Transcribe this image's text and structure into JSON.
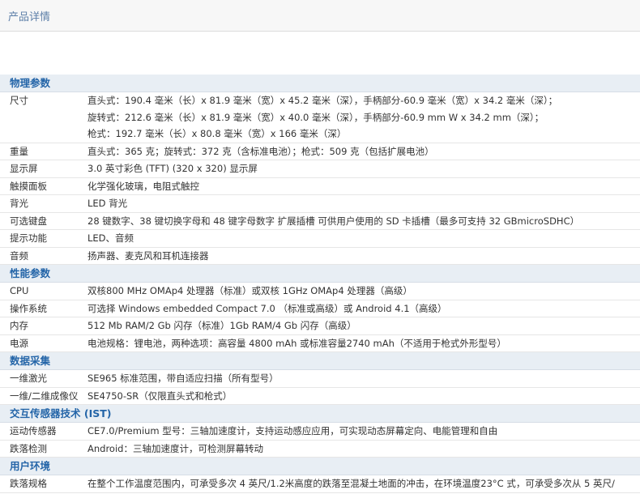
{
  "tab": {
    "label": "产品详情"
  },
  "sections": [
    {
      "title": "物理参数",
      "rows": [
        {
          "key": "尺寸",
          "lines": [
            "直头式：190.4 毫米（长）x 81.9 毫米（宽）x 45.2 毫米（深），手柄部分-60.9 毫米（宽）x 34.2 毫米（深）；",
            "旋转式：212.6 毫米（长）x 81.9 毫米（宽）x 40.0 毫米（深），手柄部分-60.9 mm W x 34.2 mm（深）；",
            "枪式：192.7 毫米（长）x 80.8 毫米（宽）x 166 毫米（深）"
          ]
        },
        {
          "key": "重量",
          "lines": [
            "直头式：365 克；旋转式：372 克（含标准电池）；枪式：509 克（包括扩展电池）"
          ]
        },
        {
          "key": "显示屏",
          "lines": [
            "3.0 英寸彩色 (TFT) (320 x 320) 显示屏"
          ]
        },
        {
          "key": "触摸面板",
          "lines": [
            "化学强化玻璃，电阻式触控"
          ]
        },
        {
          "key": "背光",
          "lines": [
            "LED 背光"
          ]
        },
        {
          "key": "可选键盘",
          "lines": [
            "28 键数字、38 键切换字母和 48 键字母数字 扩展插槽 可供用户使用的 SD 卡插槽（最多可支持 32 GBmicroSDHC）"
          ]
        },
        {
          "key": "提示功能",
          "lines": [
            "LED、音频"
          ]
        },
        {
          "key": "音频",
          "lines": [
            "扬声器、麦克风和耳机连接器"
          ]
        }
      ]
    },
    {
      "title": "性能参数",
      "rows": [
        {
          "key": "CPU",
          "lines": [
            "双核800 MHz OMAp4 处理器（标准）或双核 1GHz OMAp4 处理器（高级）"
          ]
        },
        {
          "key": "操作系统",
          "lines": [
            "可选择 Windows embedded Compact 7.0 （标准或高级）或 Android 4.1（高级）"
          ]
        },
        {
          "key": "内存",
          "lines": [
            "512 Mb RAM/2 Gb 闪存（标准）1Gb RAM/4 Gb 闪存（高级）"
          ]
        },
        {
          "key": "电源",
          "lines": [
            "电池规格：锂电池，两种选项：高容量 4800 mAh 或标准容量2740 mAh（不适用于枪式外形型号）"
          ]
        }
      ]
    },
    {
      "title": "数据采集",
      "rows": [
        {
          "key": "一维激光",
          "lines": [
            "SE965 标准范围，带自适应扫描（所有型号）"
          ]
        },
        {
          "key": "一维/二维成像仪",
          "lines": [
            "SE4750-SR（仅限直头式和枪式）"
          ]
        }
      ]
    },
    {
      "title": "交互传感器技术 (IST)",
      "rows": [
        {
          "key": "运动传感器",
          "lines": [
            "CE7.0/Premium 型号：三轴加速度计，支持运动感应应用，可实现动态屏幕定向、电能管理和自由"
          ]
        },
        {
          "key": "跌落检测",
          "lines": [
            "Android：三轴加速度计，可检测屏幕转动"
          ]
        }
      ]
    },
    {
      "title": "用户环境",
      "rows": [
        {
          "key": "跌落规格",
          "lines": [
            "在整个工作温度范围内，可承受多次 4 英尺/1.2米高度的跌落至混凝土地面的冲击，在环境温度23°C 式，可承受多次从 5 英尺/"
          ]
        }
      ]
    }
  ]
}
